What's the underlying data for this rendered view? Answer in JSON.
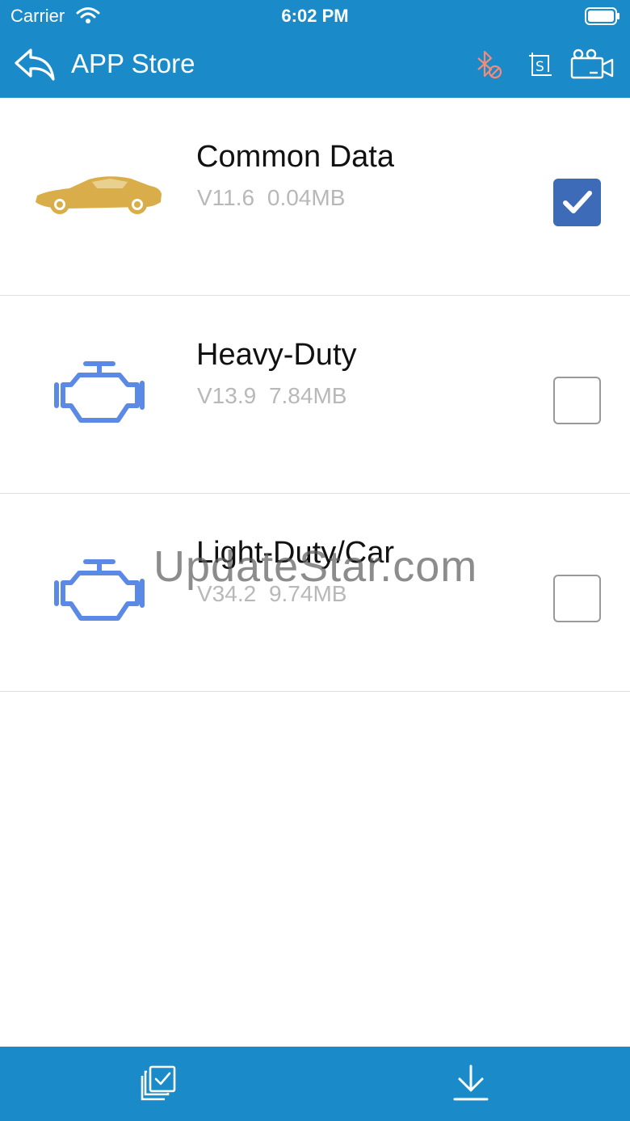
{
  "status_bar": {
    "carrier": "Carrier",
    "time": "6:02 PM"
  },
  "header": {
    "title": "APP Store",
    "icons": [
      "back-icon",
      "bluetooth-disabled-icon",
      "s-icon",
      "camera-icon"
    ]
  },
  "colors": {
    "bar": "#1a8ac8",
    "checked": "#3d6bb7",
    "car_icon": "#d9ae4a",
    "engine_icon": "#5b8ae6"
  },
  "apps": [
    {
      "name": "Common Data",
      "version": "V11.6",
      "size": "0.04MB",
      "icon": "car-icon",
      "checked": true
    },
    {
      "name": "Heavy-Duty",
      "version": "V13.9",
      "size": "7.84MB",
      "icon": "engine-icon",
      "checked": false
    },
    {
      "name": "Light-Duty/Car",
      "version": "V34.2",
      "size": "9.74MB",
      "icon": "engine-icon",
      "checked": false
    }
  ],
  "watermark": "UpdateStar.com",
  "bottom_bar": {
    "icons": [
      "select-all-icon",
      "download-icon"
    ]
  }
}
